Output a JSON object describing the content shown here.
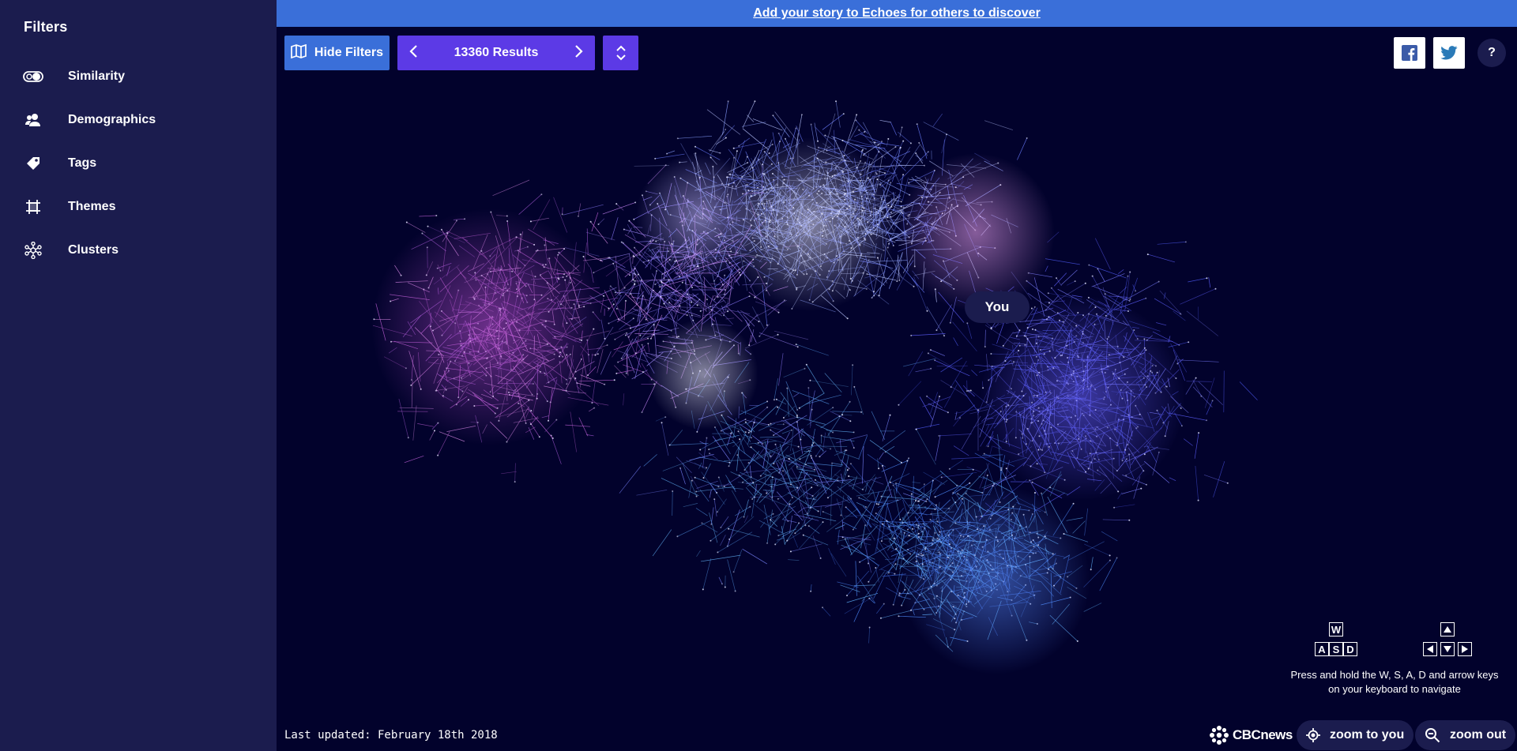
{
  "sidebar": {
    "title": "Filters",
    "items": [
      {
        "label": "Similarity",
        "icon": "toggle-icon"
      },
      {
        "label": "Demographics",
        "icon": "people-icon"
      },
      {
        "label": "Tags",
        "icon": "tag-icon"
      },
      {
        "label": "Themes",
        "icon": "frame-icon"
      },
      {
        "label": "Clusters",
        "icon": "cluster-icon"
      }
    ]
  },
  "banner": {
    "link_text": "Add your story to Echoes for others to discover"
  },
  "toolbar": {
    "hide_filters_label": "Hide Filters",
    "results_label": "13360 Results"
  },
  "map": {
    "you_label": "You"
  },
  "keys": {
    "wasd": [
      "W",
      "A",
      "S",
      "D"
    ]
  },
  "nav_hint": "Press and hold the W, S, A, D and arrow keys on your keyboard to navigate",
  "footer": {
    "last_updated": "Last updated: February 18th 2018",
    "brand": "CBCnews",
    "zoom_to_you_label": "zoom to you",
    "zoom_out_label": "zoom out"
  },
  "colors": {
    "background": "#02022c",
    "sidebar": "#1b1c4e",
    "banner": "#3a6fd9",
    "accent": "#5c3ae6"
  }
}
